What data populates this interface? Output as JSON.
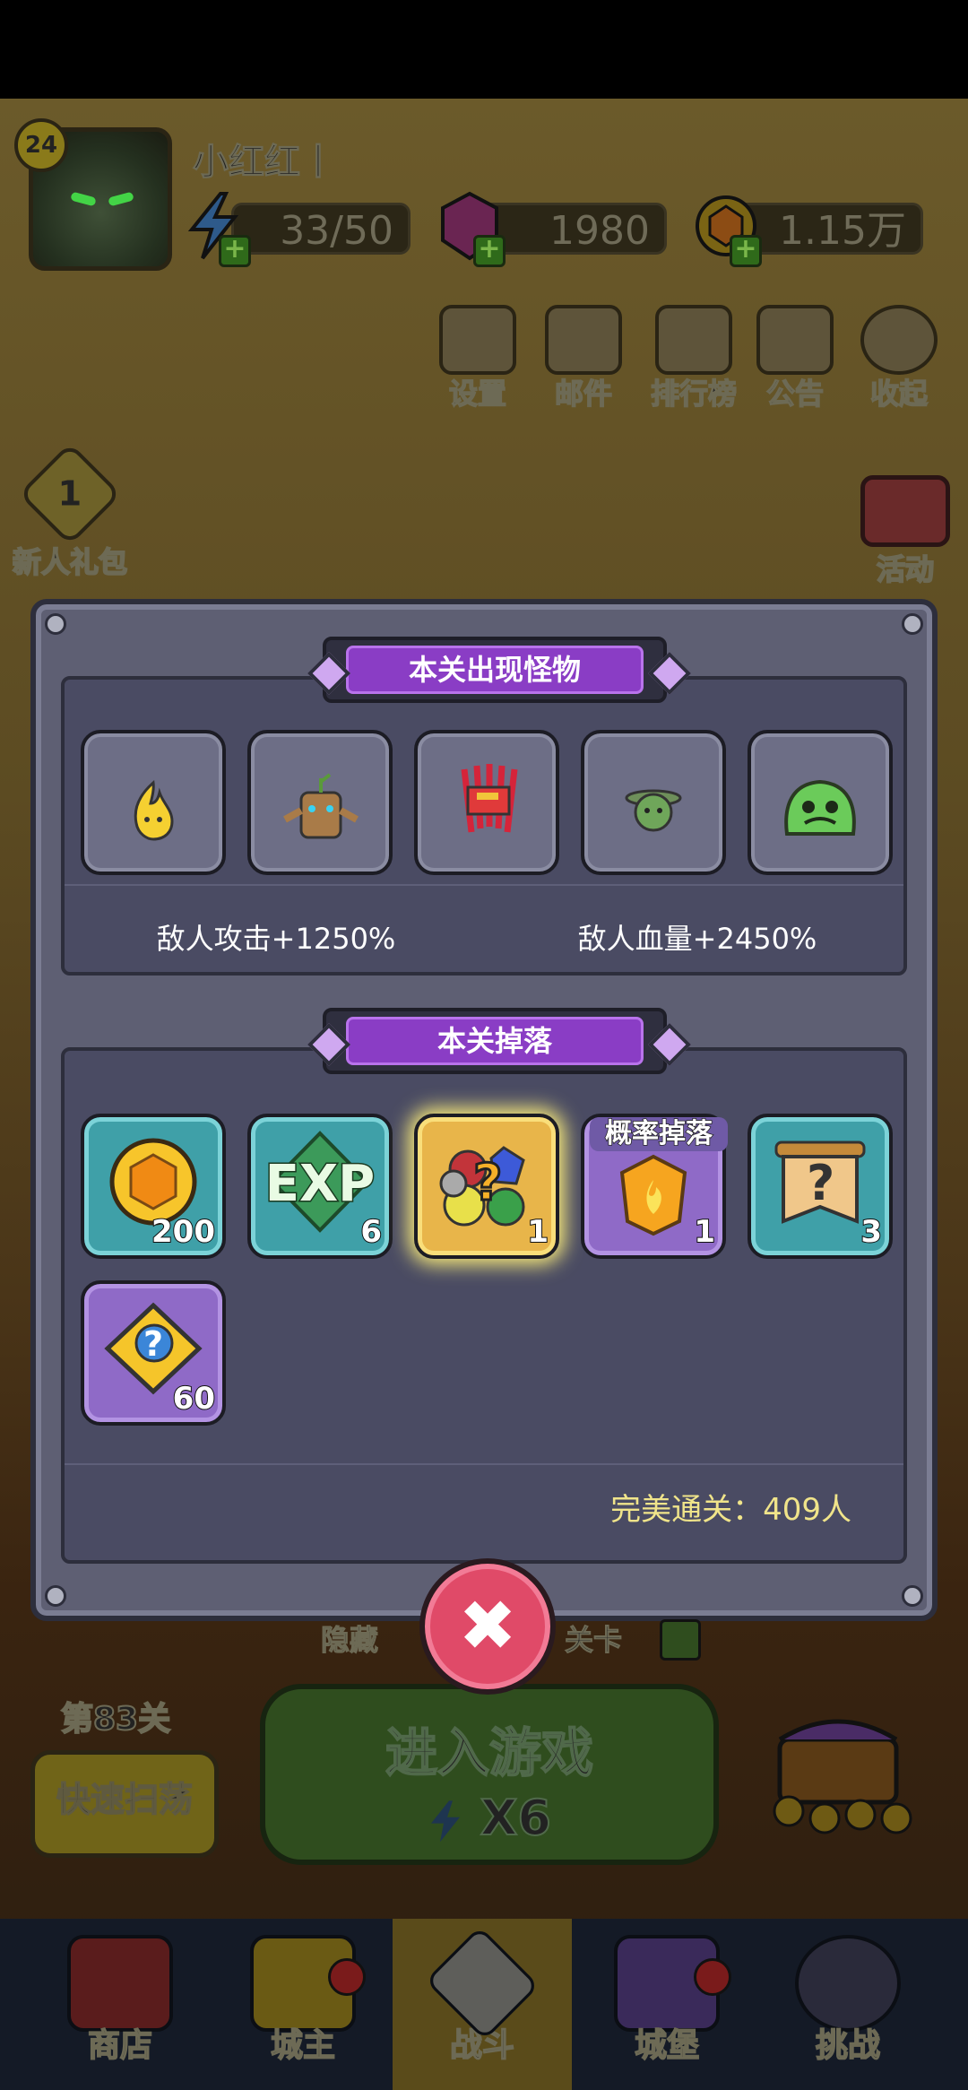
{
  "player": {
    "level": "24",
    "name": "小红红丨"
  },
  "resources": {
    "energy": "33/50",
    "gems": "1980",
    "gold": "1.15万"
  },
  "top_menu": [
    {
      "label": "设置",
      "icon": "gear-icon"
    },
    {
      "label": "邮件",
      "icon": "mail-icon"
    },
    {
      "label": "排行榜",
      "icon": "ranking-icon"
    },
    {
      "label": "公告",
      "icon": "megaphone-icon"
    },
    {
      "label": "收起",
      "icon": "collapse-icon"
    }
  ],
  "side": {
    "newbie_num": "1",
    "newbie_label": "新人礼包",
    "activity_label": "活动"
  },
  "modal": {
    "monsters_title": "本关出现怪物",
    "monsters": [
      "flame-sprite-icon",
      "tree-stump-icon",
      "red-crab-icon",
      "green-slime-hat-icon",
      "green-blob-icon"
    ],
    "enemy_attack_label": "敌人攻击",
    "enemy_attack_value": "+1250%",
    "enemy_hp_label": "敌人血量",
    "enemy_hp_value": "+2450%",
    "drops_title": "本关掉落",
    "drops": [
      {
        "icon": "gold-coin-icon",
        "count": "200",
        "style": "teal",
        "tag": ""
      },
      {
        "icon": "exp-icon",
        "count": "6",
        "style": "teal",
        "tag": "",
        "text": "EXP"
      },
      {
        "icon": "mystery-gem-pack-icon",
        "count": "1",
        "style": "gold",
        "tag": ""
      },
      {
        "icon": "fire-crest-icon",
        "count": "1",
        "style": "purple",
        "tag": "概率掉落"
      },
      {
        "icon": "mystery-scroll-icon",
        "count": "3",
        "style": "teal",
        "tag": ""
      },
      {
        "icon": "mystery-puzzle-icon",
        "count": "60",
        "style": "purple",
        "tag": ""
      }
    ],
    "perfect_clear": "完美通关：409人"
  },
  "lower": {
    "hidden_left": "隐藏",
    "hidden_right": "关卡",
    "stage": "第83关",
    "quick_sweep": "快速扫荡",
    "enter_game": "进入游戏",
    "energy_cost": "X6"
  },
  "bottom_nav": [
    {
      "label": "商店",
      "icon": "shop-icon",
      "active": false
    },
    {
      "label": "城主",
      "icon": "crown-icon",
      "active": false
    },
    {
      "label": "战斗",
      "icon": "crossed-swords-icon",
      "active": true
    },
    {
      "label": "城堡",
      "icon": "castle-icon",
      "active": false
    },
    {
      "label": "挑战",
      "icon": "demon-icon",
      "active": false
    }
  ],
  "colors": {
    "modal_bg": "#5e5f73",
    "title_purple": "#8a3dc5",
    "bonus_green": "#6ee06e",
    "perfect_yellow": "#f0e48a",
    "close_red": "#e04a68"
  }
}
